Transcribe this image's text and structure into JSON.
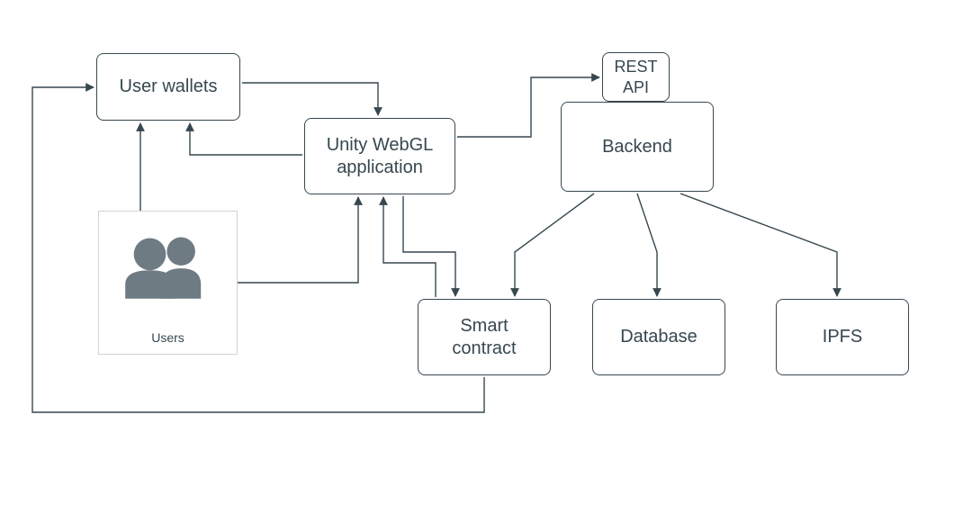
{
  "nodes": {
    "user_wallets": "User wallets",
    "unity": "Unity WebGL application",
    "rest_api": "REST API",
    "backend": "Backend",
    "smart_contract": "Smart contract",
    "database": "Database",
    "ipfs": "IPFS",
    "users": "Users"
  },
  "edges": [
    {
      "from": "users",
      "to": "user_wallets",
      "dir": "one"
    },
    {
      "from": "users",
      "to": "unity",
      "dir": "one"
    },
    {
      "from": "user_wallets",
      "to": "unity",
      "dir": "two"
    },
    {
      "from": "unity",
      "to": "rest_api",
      "dir": "one"
    },
    {
      "from": "unity",
      "to": "smart_contract",
      "dir": "two"
    },
    {
      "from": "backend",
      "to": "smart_contract",
      "dir": "one"
    },
    {
      "from": "backend",
      "to": "database",
      "dir": "one"
    },
    {
      "from": "backend",
      "to": "ipfs",
      "dir": "one"
    },
    {
      "from": "smart_contract",
      "to": "user_wallets",
      "dir": "one"
    }
  ],
  "colors": {
    "stroke": "#37474f",
    "icon": "#6f7b82"
  }
}
